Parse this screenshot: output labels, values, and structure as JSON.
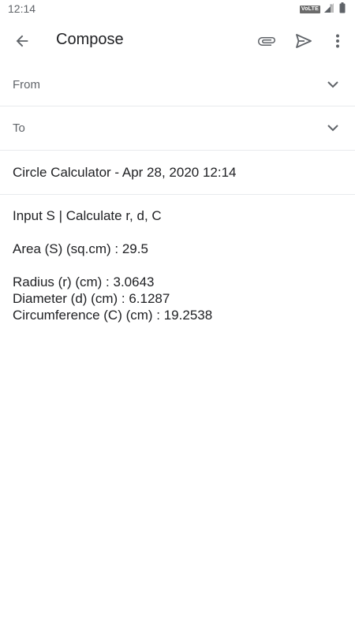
{
  "status_bar": {
    "time": "12:14",
    "network_badge": "VoLTE",
    "icons": [
      "volte-icon",
      "signal-icon",
      "battery-icon"
    ]
  },
  "app_bar": {
    "title": "Compose",
    "icons": [
      "back-arrow-icon",
      "paperclip-icon",
      "send-icon",
      "more-vert-icon"
    ]
  },
  "fields": {
    "from_label": "From",
    "to_label": "To",
    "subject": "Circle Calculator - Apr 28, 2020 12:14"
  },
  "body": {
    "line1": "Input S | Calculate r, d, C",
    "line2": "Area (S) (sq.cm) : 29.5",
    "line3": "Radius (r) (cm) : 3.0643",
    "line4": "Diameter (d) (cm) : 6.1287",
    "line5": "Circumference (C) (cm) : 19.2538"
  },
  "colors": {
    "text_primary": "#202124",
    "text_secondary": "#5f6368",
    "divider": "#e8eaed",
    "icon": "#5f6368"
  }
}
